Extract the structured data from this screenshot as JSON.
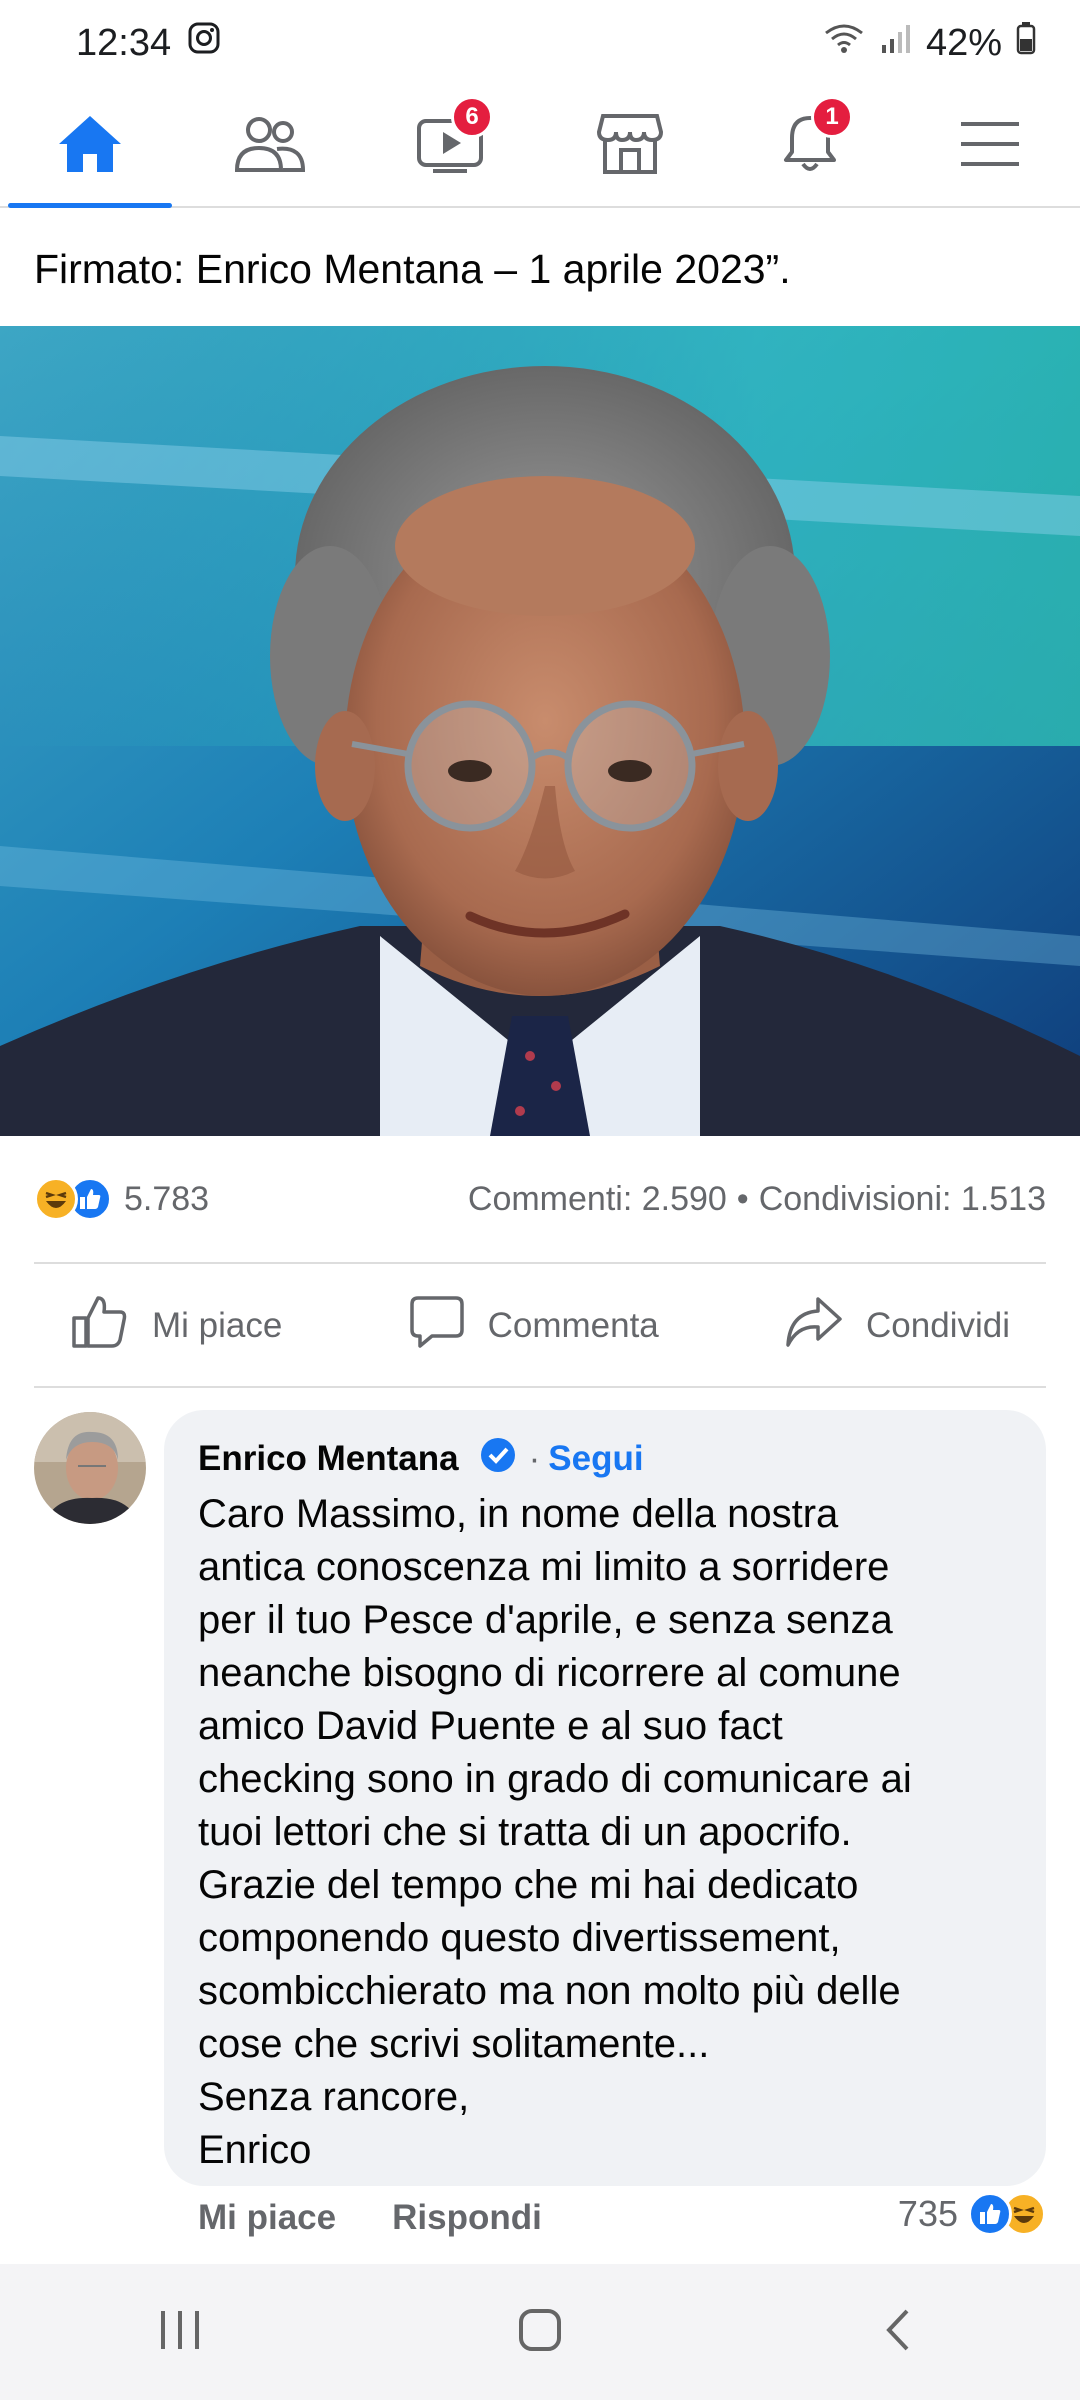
{
  "status_bar": {
    "time": "12:34",
    "battery": "42%"
  },
  "nav": {
    "video_badge": "6",
    "notifications_badge": "1"
  },
  "post": {
    "caption": "Firmato: Enrico Mentana – 1 aprile 2023”.",
    "reactions_count": "5.783",
    "comments": "Commenti: 2.590",
    "separator": "•",
    "shares": "Condivisioni: 1.513",
    "actions": {
      "like": "Mi piace",
      "comment": "Commenta",
      "share": "Condividi"
    }
  },
  "comment": {
    "author": "Enrico Mentana",
    "dot": "·",
    "follow": "Segui",
    "text": "Caro Massimo, in nome della nostra\nantica conoscenza mi limito a sorridere\nper il tuo Pesce d'aprile, e senza senza\nneanche bisogno di ricorrere al comune\namico David Puente e al suo fact\nchecking sono in grado di comunicare ai\ntuoi lettori che si tratta di un apocrifo.\nGrazie del tempo che mi hai dedicato\ncomponendo questo divertissement,\nscombicchierato ma non molto più delle\ncose che scrivi solitamente...\nSenza rancore,\nEnrico",
    "like": "Mi piace",
    "reply": "Rispondi",
    "reactions_count": "735"
  },
  "colors": {
    "accent": "#1877f2",
    "badge": "#e41e3f",
    "haha": "#f7b125"
  }
}
